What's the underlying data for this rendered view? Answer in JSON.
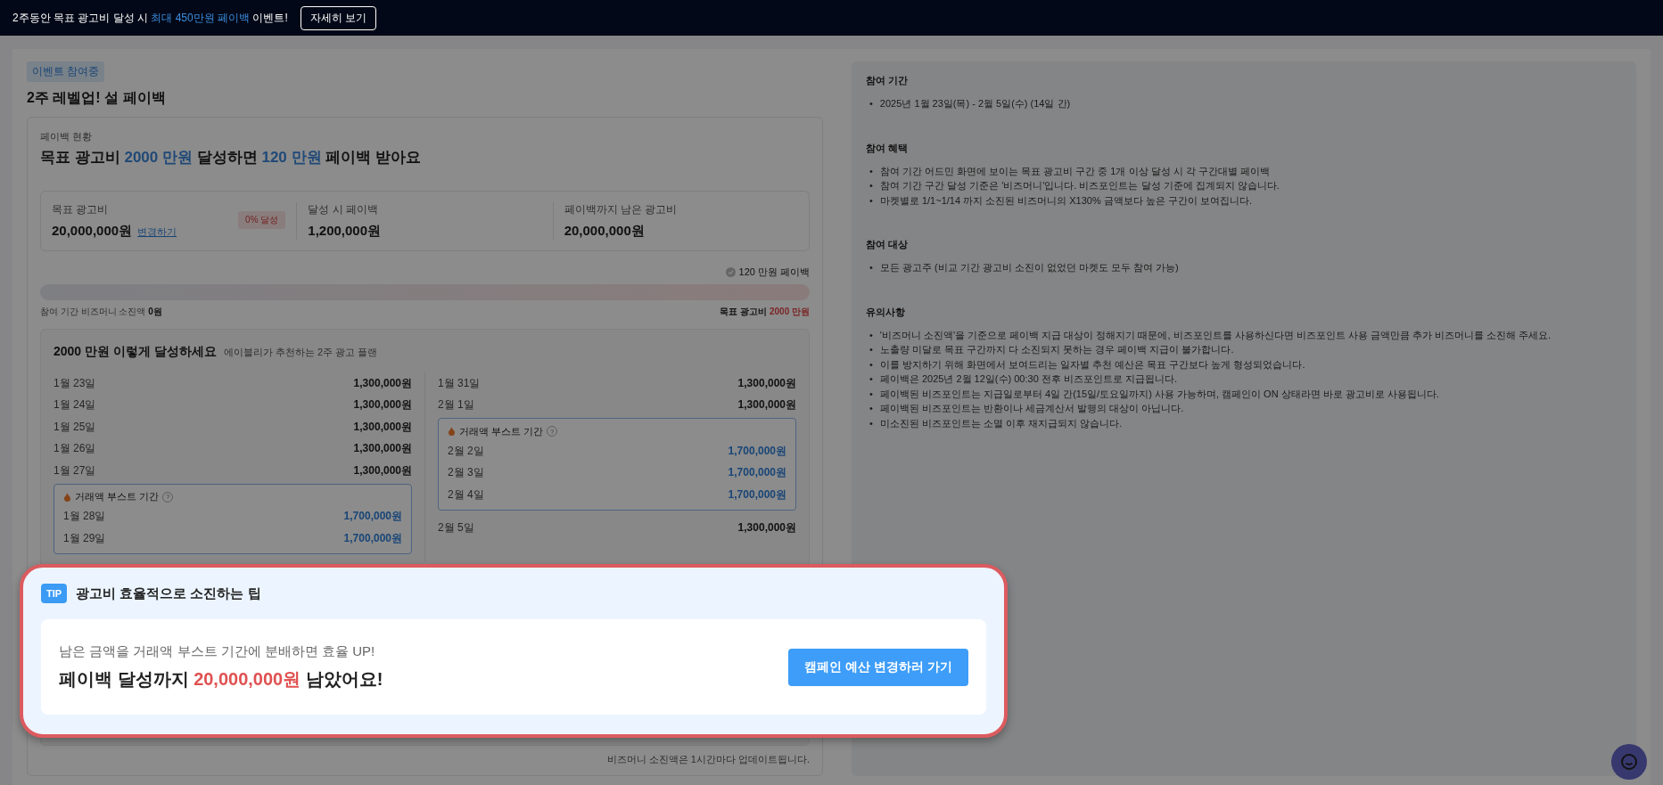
{
  "banner": {
    "text": "2주동안 목표 광고비 달성 시 **최대 450만원 페이백** 이벤트!",
    "button": "자세히 보기"
  },
  "event": {
    "badge": "이벤트 참여중",
    "title": "2주 레벨업! 설 페이백"
  },
  "status": {
    "label": "페이백 현황",
    "headline": "목표 광고비 **2000 만원** 달성하면 **120 만원** 페이백 받아요",
    "stats": [
      {
        "label": "목표 광고비",
        "value": "20,000,000원",
        "link": "변경하기",
        "badge": "0% 달성"
      },
      {
        "label": "달성 시 페이백",
        "value": "1,200,000원"
      },
      {
        "label": "페이백까지 남은 광고비",
        "value": "20,000,000원"
      }
    ],
    "milestone": "120 만원 페이백",
    "level": 0,
    "spent": "참여 기간 비즈머니 소진액 **0원**",
    "target": "목표 광고비 **2000 만원**"
  },
  "plan": {
    "title": "2000 만원 이렇게 달성하세요",
    "subtitle": "에이블리가 추천하는 2주 광고 플랜",
    "columns": [
      [
        {
          "kind": "day",
          "date": "1월 23일",
          "amount": "1,300,000원"
        },
        {
          "kind": "day",
          "date": "1월 24일",
          "amount": "1,300,000원"
        },
        {
          "kind": "day",
          "date": "1월 25일",
          "amount": "1,300,000원"
        },
        {
          "kind": "day",
          "date": "1월 26일",
          "amount": "1,300,000원"
        },
        {
          "kind": "day",
          "date": "1월 27일",
          "amount": "1,300,000원"
        },
        {
          "kind": "boost",
          "label": "거래액 부스트 기간",
          "help": "?",
          "days": [
            {
              "date": "1월 28일",
              "amount": "1,700,000원"
            },
            {
              "date": "1월 29일",
              "amount": "1,700,000원"
            }
          ]
        }
      ],
      [
        {
          "kind": "day",
          "date": "1월 31일",
          "amount": "1,300,000원"
        },
        {
          "kind": "day",
          "date": "2월 1일",
          "amount": "1,300,000원"
        },
        {
          "kind": "boost",
          "label": "거래액 부스트 기간",
          "help": "?",
          "days": [
            {
              "date": "2월 2일",
              "amount": "1,700,000원"
            },
            {
              "date": "2월 3일",
              "amount": "1,700,000원"
            },
            {
              "date": "2월 4일",
              "amount": "1,700,000원"
            }
          ]
        },
        {
          "kind": "day",
          "date": "2월 5일",
          "amount": "1,300,000원"
        }
      ]
    ],
    "footnote": "비즈머니 소진액은 1시간마다 업데이트됩니다."
  },
  "info": [
    {
      "title": "참여 기간",
      "bullet": "•",
      "items": [
        "2025년 1월 23일(목) - 2월 5일(수) (14일 간)"
      ]
    },
    {
      "title": "참여 혜택",
      "bullet": "•",
      "items": [
        "참여 기간 어드민 화면에 보이는 목표 광고비 구간 중 1개 이상 달성 시 각 구간대별 페이백",
        "참여 기간 구간 달성 기준은 '비즈머니'입니다. 비즈포인트는 달성 기준에 집계되지 않습니다.",
        "마켓별로 1/1~1/14 까지 소진된 비즈머니의 X130% 금액보다 높은 구간이 보여집니다."
      ]
    },
    {
      "title": "참여 대상",
      "bullet": "•",
      "items": [
        "모든 광고주 (비교 기간 광고비 소진이 없었던 마켓도 모두 참여 가능)"
      ]
    },
    {
      "title": "유의사항",
      "bullet": "•",
      "items": [
        "'비즈머니 소진액'을 기준으로 페이백 지급 대상이 정해지기 때문에, 비즈포인트를 사용하신다면 비즈포인트 사용 금액만큼 추가 비즈머니를 소진해 주세요.",
        "노출량 미달로 목표 구간까지 다 소진되지 못하는 경우 페이백 지급이 불가합니다.",
        "이를 방지하기 위해 화면에서 보여드리는 일자별 추천 예산은 목표 구간보다 높게 형성되었습니다.",
        "페이백은 2025년 2월 12일(수) 00:30 전후 비즈포인트로 지급됩니다.",
        "페이백된 비즈포인트는 지급일로부터 4일 간(15일/토요일까지) 사용 가능하며, 캠페인이 ON 상태라면 바로 광고비로 사용됩니다.",
        "페이백된 비즈포인트는 반환이나 세금계산서 발행의 대상이 아닙니다.",
        "미소진된 비즈포인트는 소멸 이후 재지급되지 않습니다."
      ]
    }
  ],
  "tip": {
    "badge": "TIP",
    "title": "광고비 효율적으로 소진하는 팁",
    "hint": "남은 금액을 거래액 부스트 기간에 분배하면 효율 UP!",
    "message": "페이백 달성까지 **20,000,000원** 남았어요!",
    "button": "캠페인 예산 변경하러 가기"
  }
}
